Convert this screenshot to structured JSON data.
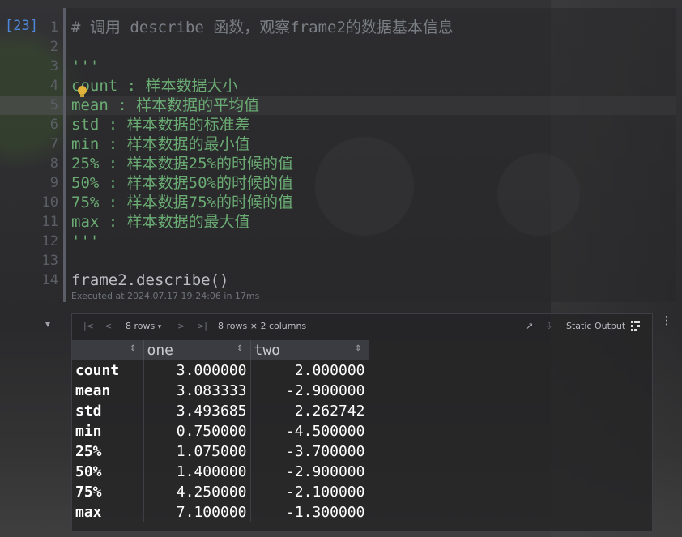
{
  "cell": {
    "execution_count": "[23]",
    "line_numbers": [
      "1",
      "2",
      "3",
      "4",
      "5",
      "6",
      "7",
      "8",
      "9",
      "10",
      "11",
      "12",
      "13",
      "14"
    ],
    "lines": [
      {
        "kind": "comment",
        "text": "# 调用 describe 函数，观察frame2的数据基本信息"
      },
      {
        "kind": "code",
        "text": ""
      },
      {
        "kind": "doc",
        "text": "'''"
      },
      {
        "kind": "doc",
        "text": "count : 样本数据大小"
      },
      {
        "kind": "doc",
        "text": "mean : 样本数据的平均值"
      },
      {
        "kind": "doc",
        "text": "std : 样本数据的标准差"
      },
      {
        "kind": "doc",
        "text": "min : 样本数据的最小值"
      },
      {
        "kind": "doc",
        "text": "25% : 样本数据25%的时候的值"
      },
      {
        "kind": "doc",
        "text": "50% : 样本数据50%的时候的值"
      },
      {
        "kind": "doc",
        "text": "75% : 样本数据75%的时候的值"
      },
      {
        "kind": "doc",
        "text": "max : 样本数据的最大值"
      },
      {
        "kind": "doc",
        "text": "'''"
      },
      {
        "kind": "code",
        "text": ""
      },
      {
        "kind": "code",
        "text": "frame2.describe()"
      }
    ],
    "current_line": 5,
    "exec_info": "Executed at 2024.07.17 19:24:06 in 17ms"
  },
  "output": {
    "toolbar": {
      "first_page_icon": "|<",
      "prev_page_icon": "<",
      "rows_select": "8 rows",
      "next_page_icon": ">",
      "last_page_icon": ">|",
      "summary": "8 rows × 2 columns",
      "open_icon": "↗",
      "download_icon": "⇩",
      "static_output_label": "Static Output",
      "more_icon": "⋮"
    },
    "table": {
      "columns": [
        "",
        "one",
        "two"
      ],
      "rows": [
        {
          "index": "count",
          "one": "3.000000",
          "two": "2.000000"
        },
        {
          "index": "mean",
          "one": "3.083333",
          "two": "-2.900000"
        },
        {
          "index": "std",
          "one": "3.493685",
          "two": "2.262742"
        },
        {
          "index": "min",
          "one": "0.750000",
          "two": "-4.500000"
        },
        {
          "index": "25%",
          "one": "1.075000",
          "two": "-3.700000"
        },
        {
          "index": "50%",
          "one": "1.400000",
          "two": "-2.900000"
        },
        {
          "index": "75%",
          "one": "4.250000",
          "two": "-2.100000"
        },
        {
          "index": "max",
          "one": "7.100000",
          "two": "-1.300000"
        }
      ]
    }
  },
  "colors": {
    "background": "#2c2c2e",
    "comment": "#7a7e85",
    "docstring": "#6aab73",
    "execution_count": "#4e86d8",
    "table_header_bg": "#3a3c41"
  }
}
